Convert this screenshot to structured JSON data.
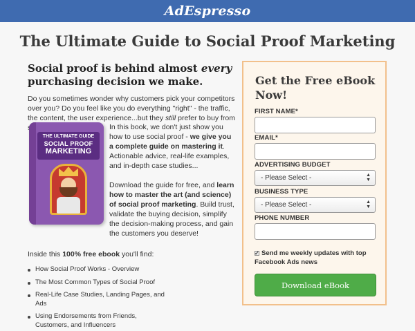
{
  "header": {
    "logo": "AdEspresso"
  },
  "title": "The Ultimate Guide to Social Proof Marketing",
  "intro": {
    "headline_pre": "Social proof is behind almost ",
    "headline_em": "every",
    "headline_post": " purchasing decision we make.",
    "para_pre": "Do you sometimes wonder why customers pick your competitors over you? Do you feel like you do everything \"right\" - the traffic, the content, the user experience...but they ",
    "para_em": "still",
    "para_post": " prefer to buy from someone else?"
  },
  "book": {
    "cover_line1": "THE ULTIMATE GUIDE",
    "cover_line2": "SOCIAL PROOF",
    "cover_line3": "MARKETING",
    "p1_pre": "In this book, we don't just show you how to use social proof - ",
    "p1_bold": "we give you a complete guide on mastering it",
    "p1_post": ". Actionable advice, real-life examples, and in-depth case studies...",
    "p2_pre": "Download the guide for free, and ",
    "p2_bold": "learn how to master the art (and science) of social proof marketing",
    "p2_post": ". Build trust, validate the buying decision, simplify the decision-making process, and gain the customers you deserve!"
  },
  "inside": {
    "pre": "Inside this ",
    "bold": "100% free ebook",
    "post": " you'll find:"
  },
  "bullets": [
    "How Social Proof Works - Overview",
    "The Most Common Types of Social Proof",
    "Real-Life Case Studies, Landing Pages, and Ads",
    "Using Endorsements from Friends, Customers, and Influencers"
  ],
  "form": {
    "title": "Get the Free eBook Now!",
    "first_name_label": "FIRST NAME*",
    "email_label": "EMAIL*",
    "budget_label": "ADVERTISING BUDGET",
    "budget_value": "- Please Select -",
    "business_label": "BUSINESS TYPE",
    "business_value": "- Please Select -",
    "phone_label": "PHONE NUMBER",
    "checkbox_label": "Send me weekly updates with top Facebook Ads news",
    "button_label": "Download eBook"
  },
  "colors": {
    "header": "#3f6bb0",
    "button": "#4fac48",
    "form_border": "#f2c08b"
  }
}
